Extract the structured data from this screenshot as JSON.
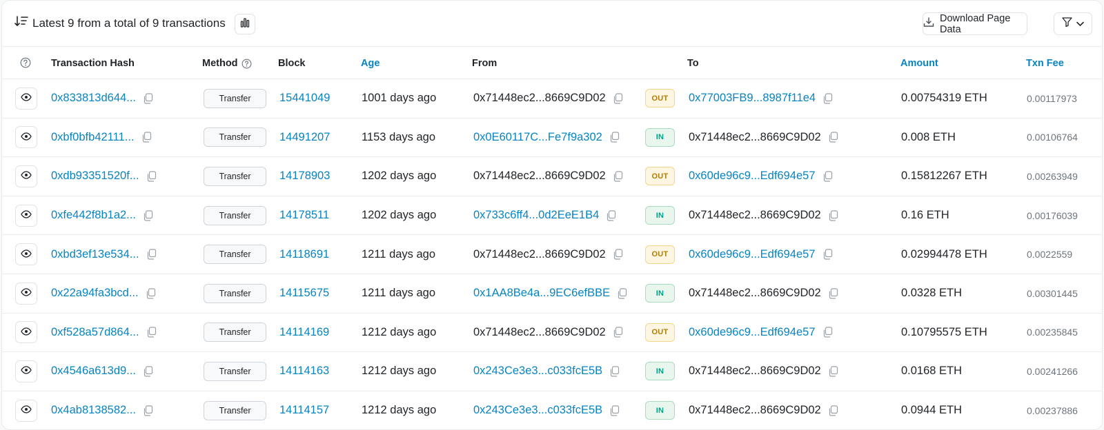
{
  "header": {
    "summary": "Latest 9 from a total of 9 transactions",
    "download_label": "Download Page Data"
  },
  "columns": {
    "hash": "Transaction Hash",
    "method": "Method",
    "block": "Block",
    "age": "Age",
    "from": "From",
    "to": "To",
    "amount": "Amount",
    "fee": "Txn Fee"
  },
  "colors": {
    "link": "#0784c3",
    "out": "#b47d00",
    "in": "#00a186"
  },
  "rows": [
    {
      "hash": "0x833813d644...",
      "method": "Transfer",
      "block": "15441049",
      "age": "1001 days ago",
      "from": "0x71448ec2...8669C9D02",
      "from_link": false,
      "dir": "OUT",
      "to": "0x77003FB9...8987f11e4",
      "to_link": true,
      "amount": "0.00754319 ETH",
      "fee": "0.00117973"
    },
    {
      "hash": "0xbf0bfb42111...",
      "method": "Transfer",
      "block": "14491207",
      "age": "1153 days ago",
      "from": "0x0E60117C...Fe7f9a302",
      "from_link": true,
      "dir": "IN",
      "to": "0x71448ec2...8669C9D02",
      "to_link": false,
      "amount": "0.008 ETH",
      "fee": "0.00106764"
    },
    {
      "hash": "0xdb93351520f...",
      "method": "Transfer",
      "block": "14178903",
      "age": "1202 days ago",
      "from": "0x71448ec2...8669C9D02",
      "from_link": false,
      "dir": "OUT",
      "to": "0x60de96c9...Edf694e57",
      "to_link": true,
      "amount": "0.15812267 ETH",
      "fee": "0.00263949"
    },
    {
      "hash": "0xfe442f8b1a2...",
      "method": "Transfer",
      "block": "14178511",
      "age": "1202 days ago",
      "from": "0x733c6ff4...0d2EeE1B4",
      "from_link": true,
      "dir": "IN",
      "to": "0x71448ec2...8669C9D02",
      "to_link": false,
      "amount": "0.16 ETH",
      "fee": "0.00176039"
    },
    {
      "hash": "0xbd3ef13e534...",
      "method": "Transfer",
      "block": "14118691",
      "age": "1211 days ago",
      "from": "0x71448ec2...8669C9D02",
      "from_link": false,
      "dir": "OUT",
      "to": "0x60de96c9...Edf694e57",
      "to_link": true,
      "amount": "0.02994478 ETH",
      "fee": "0.0022559"
    },
    {
      "hash": "0x22a94fa3bcd...",
      "method": "Transfer",
      "block": "14115675",
      "age": "1211 days ago",
      "from": "0x1AA8Be4a...9EC6efBBE",
      "from_link": true,
      "dir": "IN",
      "to": "0x71448ec2...8669C9D02",
      "to_link": false,
      "amount": "0.0328 ETH",
      "fee": "0.00301445"
    },
    {
      "hash": "0xf528a57d864...",
      "method": "Transfer",
      "block": "14114169",
      "age": "1212 days ago",
      "from": "0x71448ec2...8669C9D02",
      "from_link": false,
      "dir": "OUT",
      "to": "0x60de96c9...Edf694e57",
      "to_link": true,
      "amount": "0.10795575 ETH",
      "fee": "0.00235845"
    },
    {
      "hash": "0x4546a613d9...",
      "method": "Transfer",
      "block": "14114163",
      "age": "1212 days ago",
      "from": "0x243Ce3e3...c033fcE5B",
      "from_link": true,
      "dir": "IN",
      "to": "0x71448ec2...8669C9D02",
      "to_link": false,
      "amount": "0.0168 ETH",
      "fee": "0.00241266"
    },
    {
      "hash": "0x4ab8138582...",
      "method": "Transfer",
      "block": "14114157",
      "age": "1212 days ago",
      "from": "0x243Ce3e3...c033fcE5B",
      "from_link": true,
      "dir": "IN",
      "to": "0x71448ec2...8669C9D02",
      "to_link": false,
      "amount": "0.0944 ETH",
      "fee": "0.00237886"
    }
  ]
}
